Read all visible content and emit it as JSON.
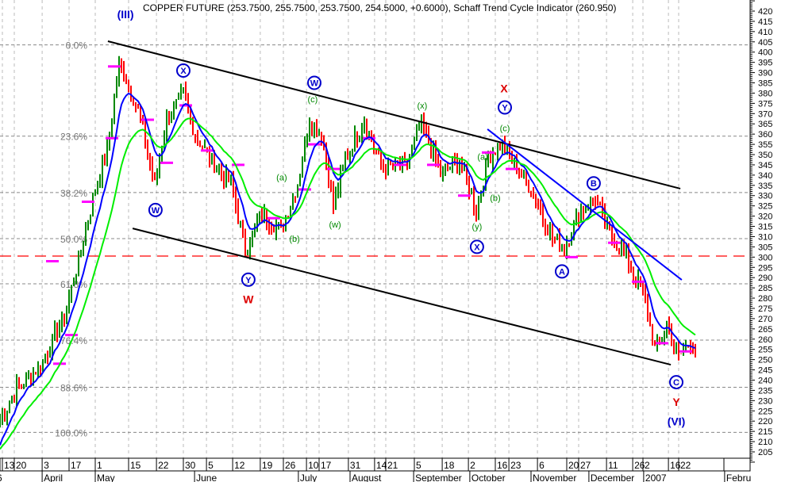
{
  "chart_data": {
    "type": "line",
    "title": "COPPER FUTURE (253.7500, 255.7500, 253.7500, 254.5000, +0.6000), Schaff Trend Cycle Indicator (260.950)",
    "ylim": [
      205,
      420
    ],
    "y_ticks": [
      205,
      210,
      215,
      220,
      225,
      230,
      235,
      240,
      245,
      250,
      255,
      260,
      265,
      270,
      275,
      280,
      285,
      290,
      295,
      300,
      305,
      310,
      315,
      320,
      325,
      330,
      335,
      340,
      345,
      350,
      355,
      360,
      365,
      370,
      375,
      380,
      385,
      390,
      395,
      400,
      405,
      410,
      415,
      420
    ],
    "xlim_bars": [
      0,
      315
    ],
    "day_ticks": [
      {
        "label": "13",
        "bar": 1
      },
      {
        "label": "20",
        "bar": 6
      },
      {
        "label": "3",
        "bar": 17.7
      },
      {
        "label": "17",
        "bar": 29
      },
      {
        "label": "1",
        "bar": 40
      },
      {
        "label": "15",
        "bar": 54
      },
      {
        "label": "22",
        "bar": 65.7
      },
      {
        "label": "30",
        "bar": 77
      },
      {
        "label": "5",
        "bar": 86.7
      },
      {
        "label": "12",
        "bar": 97.7
      },
      {
        "label": "19",
        "bar": 109.3
      },
      {
        "label": "26",
        "bar": 119
      },
      {
        "label": "10",
        "bar": 128.7
      },
      {
        "label": "17",
        "bar": 134
      },
      {
        "label": "31",
        "bar": 146.3
      },
      {
        "label": "14",
        "bar": 157.3
      },
      {
        "label": "21",
        "bar": 162
      },
      {
        "label": "5",
        "bar": 174
      },
      {
        "label": "18",
        "bar": 185.7
      },
      {
        "label": "2",
        "bar": 196.7
      },
      {
        "label": "16",
        "bar": 208
      },
      {
        "label": "23",
        "bar": 213.7
      },
      {
        "label": "6",
        "bar": 225.7
      },
      {
        "label": "20",
        "bar": 238
      },
      {
        "label": "27",
        "bar": 243
      },
      {
        "label": "11",
        "bar": 254.7
      },
      {
        "label": "26",
        "bar": 265.7
      },
      {
        "label": "2",
        "bar": 270
      },
      {
        "label": "16",
        "bar": 280.7
      },
      {
        "label": "22",
        "bar": 285
      }
    ],
    "month_ticks": [
      {
        "label": "6",
        "bar": -2
      },
      {
        "label": "April",
        "bar": 17.7
      },
      {
        "label": "May",
        "bar": 40
      },
      {
        "label": "June",
        "bar": 81.7
      },
      {
        "label": "July",
        "bar": 125.3
      },
      {
        "label": "August",
        "bar": 147
      },
      {
        "label": "September",
        "bar": 173.7
      },
      {
        "label": "October",
        "bar": 197.3
      },
      {
        "label": "November",
        "bar": 223
      },
      {
        "label": "December",
        "bar": 247.3
      },
      {
        "label": "2007",
        "bar": 270.3
      },
      {
        "label": "Febru",
        "bar": 304.3
      }
    ],
    "fib_levels": [
      {
        "label": "0.0%",
        "price": 403.5
      },
      {
        "label": "23.6%",
        "price": 359
      },
      {
        "label": "38.2%",
        "price": 331.5
      },
      {
        "label": "50.0%",
        "price": 309
      },
      {
        "label": "61.8%",
        "price": 287
      },
      {
        "label": "76.4%",
        "price": 259.5
      },
      {
        "label": "88.6%",
        "price": 236.5
      },
      {
        "label": "100.0%",
        "price": 214.5
      }
    ],
    "reference_line": {
      "price": 300.5,
      "color": "#ff0000"
    },
    "price_path": [
      [
        0,
        220
      ],
      [
        7,
        236
      ],
      [
        17,
        247
      ],
      [
        27,
        271
      ],
      [
        33,
        298
      ],
      [
        40,
        333
      ],
      [
        45,
        352
      ],
      [
        50,
        394
      ],
      [
        53,
        387
      ],
      [
        58,
        371
      ],
      [
        65,
        336
      ],
      [
        70,
        367
      ],
      [
        77,
        379
      ],
      [
        82,
        360
      ],
      [
        88,
        348
      ],
      [
        97,
        336
      ],
      [
        103,
        304
      ],
      [
        110,
        321
      ],
      [
        118,
        313
      ],
      [
        125,
        336
      ],
      [
        130,
        367
      ],
      [
        135,
        360
      ],
      [
        140,
        325
      ],
      [
        145,
        348
      ],
      [
        153,
        367
      ],
      [
        160,
        344
      ],
      [
        170,
        344
      ],
      [
        177,
        365
      ],
      [
        185,
        340
      ],
      [
        193,
        348
      ],
      [
        200,
        323
      ],
      [
        205,
        348
      ],
      [
        210,
        356
      ],
      [
        217,
        344
      ],
      [
        223,
        333
      ],
      [
        232,
        309
      ],
      [
        237,
        305
      ],
      [
        243,
        321
      ],
      [
        250,
        329
      ],
      [
        255,
        313
      ],
      [
        262,
        302
      ],
      [
        270,
        282
      ],
      [
        275,
        255
      ],
      [
        280,
        267
      ],
      [
        285,
        251
      ],
      [
        290,
        259
      ],
      [
        292,
        255
      ]
    ],
    "series": [
      {
        "name": "fast average",
        "color": "#0000ff",
        "period": 8
      },
      {
        "name": "slow average",
        "color": "#00ee00",
        "period": 20
      }
    ],
    "trend_lines": [
      {
        "color": "#000000",
        "from": [
          45.3,
          405.3
        ],
        "to": [
          285.7,
          333.4
        ]
      },
      {
        "color": "#000000",
        "from": [
          55.7,
          314.0
        ],
        "to": [
          281.7,
          247.5
        ]
      },
      {
        "color": "#0000ff",
        "from": [
          204.7,
          362.4
        ],
        "to": [
          286.3,
          288.9
        ]
      }
    ],
    "marker_levels": [
      [
        48,
        393
      ],
      [
        47,
        358
      ],
      [
        62,
        367
      ],
      [
        70,
        346
      ],
      [
        78,
        374
      ],
      [
        87,
        352
      ],
      [
        100,
        345
      ],
      [
        115,
        319
      ],
      [
        128,
        333
      ],
      [
        132,
        355
      ],
      [
        140,
        343
      ],
      [
        155,
        358
      ],
      [
        168,
        345
      ],
      [
        182,
        345
      ],
      [
        195,
        330
      ],
      [
        205,
        351
      ],
      [
        215,
        343
      ],
      [
        240,
        300
      ],
      [
        258,
        307
      ],
      [
        268,
        288
      ],
      [
        278,
        258
      ],
      [
        288,
        254
      ],
      [
        25,
        248
      ],
      [
        30,
        262
      ],
      [
        22,
        298
      ],
      [
        37,
        327
      ]
    ],
    "annotations": [
      {
        "text": "(III)",
        "bar": 52.7,
        "price": 418,
        "color": "#0000cc",
        "circled": false,
        "bold": true
      },
      {
        "text": "X",
        "bar": 77,
        "price": 391,
        "color": "#0000cc",
        "circled": true
      },
      {
        "text": "W",
        "bar": 65.3,
        "price": 323,
        "color": "#0000cc",
        "circled": true
      },
      {
        "text": "W",
        "bar": 132,
        "price": 385,
        "color": "#0000cc",
        "circled": true
      },
      {
        "text": "Y",
        "bar": 104.3,
        "price": 289,
        "color": "#0000cc",
        "circled": true
      },
      {
        "text": "W",
        "bar": 104.3,
        "price": 279,
        "color": "#dd0000",
        "circled": false,
        "bold": true
      },
      {
        "text": "(a)",
        "bar": 118.3,
        "price": 339,
        "color": "#008800",
        "circled": false
      },
      {
        "text": "(b)",
        "bar": 123.7,
        "price": 309,
        "color": "#008800",
        "circled": false
      },
      {
        "text": "(c)",
        "bar": 131.3,
        "price": 377,
        "color": "#008800",
        "circled": false
      },
      {
        "text": "(w)",
        "bar": 140.7,
        "price": 316,
        "color": "#008800",
        "circled": false
      },
      {
        "text": "(x)",
        "bar": 177.3,
        "price": 374,
        "color": "#008800",
        "circled": false
      },
      {
        "text": "(y)",
        "bar": 200.3,
        "price": 315,
        "color": "#008800",
        "circled": false
      },
      {
        "text": "X",
        "bar": 200.3,
        "price": 305,
        "color": "#0000cc",
        "circled": true
      },
      {
        "text": "(a)",
        "bar": 202.7,
        "price": 349,
        "color": "#008800",
        "circled": false
      },
      {
        "text": "(b)",
        "bar": 208,
        "price": 329,
        "color": "#008800",
        "circled": false
      },
      {
        "text": "(c)",
        "bar": 212,
        "price": 363,
        "color": "#008800",
        "circled": false
      },
      {
        "text": "Y",
        "bar": 212,
        "price": 373,
        "color": "#0000cc",
        "circled": true
      },
      {
        "text": "X",
        "bar": 211.7,
        "price": 382,
        "color": "#dd0000",
        "circled": false,
        "bold": true
      },
      {
        "text": "B",
        "bar": 249.3,
        "price": 336,
        "color": "#0000cc",
        "circled": true
      },
      {
        "text": "A",
        "bar": 236,
        "price": 293,
        "color": "#0000cc",
        "circled": true
      },
      {
        "text": "C",
        "bar": 284,
        "price": 239,
        "color": "#0000cc",
        "circled": true
      },
      {
        "text": "Y",
        "bar": 284,
        "price": 229,
        "color": "#dd0000",
        "circled": false,
        "bold": true
      },
      {
        "text": "(VI)",
        "bar": 284,
        "price": 219.5,
        "color": "#0000cc",
        "circled": false,
        "bold": true
      }
    ],
    "colors": {
      "up": "#008800",
      "down": "#ff0000",
      "marker": "#ff00ff",
      "fib": "#999999",
      "grid": "#bbbbbb"
    }
  }
}
